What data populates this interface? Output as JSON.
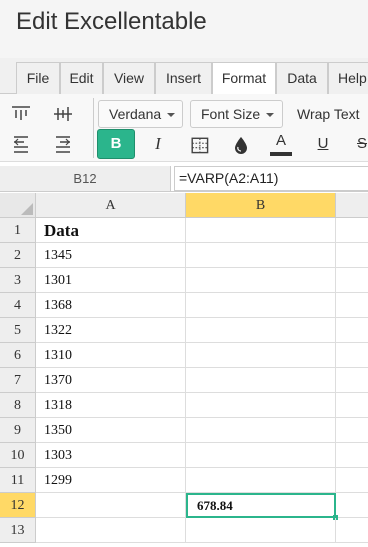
{
  "app": {
    "title": "Edit Excellentable"
  },
  "tabs": [
    {
      "label": "File",
      "active": false
    },
    {
      "label": "Edit",
      "active": false
    },
    {
      "label": "View",
      "active": false
    },
    {
      "label": "Insert",
      "active": false
    },
    {
      "label": "Format",
      "active": true
    },
    {
      "label": "Data",
      "active": false
    },
    {
      "label": "Help",
      "active": false
    }
  ],
  "toolbar": {
    "font_family": "Verdana",
    "font_size": "Font Size",
    "wrap_text": "Wrap Text",
    "bold": "B",
    "italic": "I",
    "underline": "U",
    "strikethrough": "S",
    "font_color_letter": "A",
    "accent_color": "#2bb58c"
  },
  "formula_bar": {
    "cell_ref": "B12",
    "formula": "=VARP(A2:A11)"
  },
  "sheet": {
    "columns": [
      "A",
      "B"
    ],
    "selected_column": "B",
    "selected_row": "12",
    "rows": [
      {
        "num": "1",
        "a": "Data",
        "b": ""
      },
      {
        "num": "2",
        "a": "1345",
        "b": ""
      },
      {
        "num": "3",
        "a": "1301",
        "b": ""
      },
      {
        "num": "4",
        "a": "1368",
        "b": ""
      },
      {
        "num": "5",
        "a": "1322",
        "b": ""
      },
      {
        "num": "6",
        "a": "1310",
        "b": ""
      },
      {
        "num": "7",
        "a": "1370",
        "b": ""
      },
      {
        "num": "8",
        "a": "1318",
        "b": ""
      },
      {
        "num": "9",
        "a": "1350",
        "b": ""
      },
      {
        "num": "10",
        "a": "1303",
        "b": ""
      },
      {
        "num": "11",
        "a": "1299",
        "b": ""
      },
      {
        "num": "12",
        "a": "",
        "b": "678.84"
      },
      {
        "num": "13",
        "a": "",
        "b": ""
      }
    ]
  }
}
